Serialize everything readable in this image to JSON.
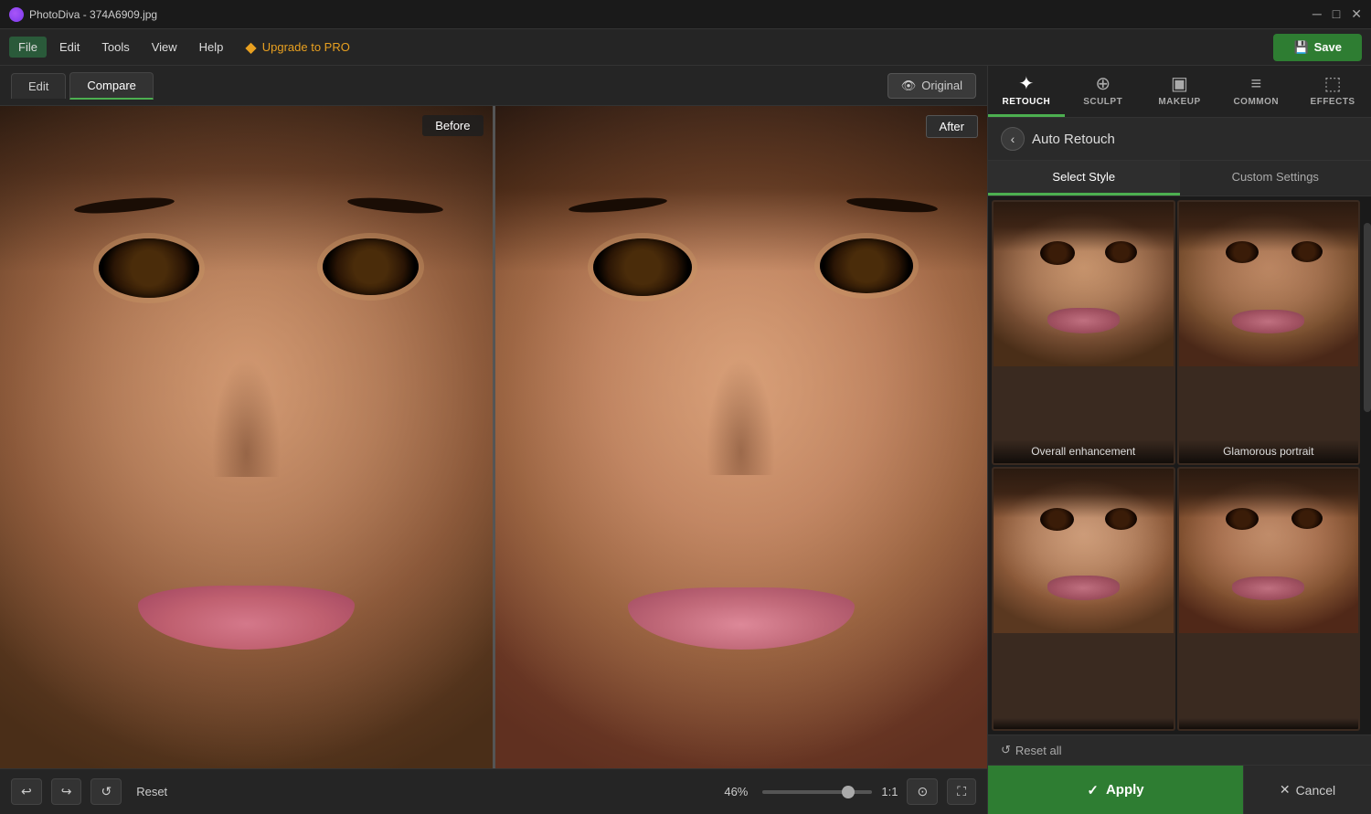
{
  "app": {
    "title": "PhotoDiva - 374A6909.jpg"
  },
  "titlebar": {
    "minimize": "─",
    "maximize": "□",
    "close": "✕"
  },
  "menubar": {
    "items": [
      "File",
      "Edit",
      "Tools",
      "View",
      "Help"
    ],
    "upgrade_label": "Upgrade to PRO",
    "save_label": "Save"
  },
  "toolbar": {
    "edit_tab": "Edit",
    "compare_tab": "Compare",
    "original_label": "Original"
  },
  "canvas": {
    "before_label": "Before",
    "after_label": "After",
    "zoom_percent": "46%",
    "zoom_ratio": "1:1",
    "reset_label": "Reset"
  },
  "panel": {
    "tabs": [
      {
        "id": "retouch",
        "label": "RETOUCH",
        "icon": "✦"
      },
      {
        "id": "sculpt",
        "label": "SCULPT",
        "icon": "⊕"
      },
      {
        "id": "makeup",
        "label": "MAKEUP",
        "icon": "⬛"
      },
      {
        "id": "common",
        "label": "COMMON",
        "icon": "≡"
      },
      {
        "id": "effects",
        "label": "EFFECTS",
        "icon": "⬚"
      }
    ],
    "active_tab": "retouch",
    "back_label": "‹",
    "title": "Auto Retouch",
    "subtabs": [
      {
        "id": "select_style",
        "label": "Select Style"
      },
      {
        "id": "custom_settings",
        "label": "Custom Settings"
      }
    ],
    "active_subtab": "select_style",
    "styles": [
      {
        "id": 1,
        "label": "Overall enhancement"
      },
      {
        "id": 2,
        "label": "Glamorous portrait"
      },
      {
        "id": 3,
        "label": ""
      },
      {
        "id": 4,
        "label": ""
      }
    ],
    "reset_label": "Reset all",
    "apply_label": "Apply",
    "cancel_label": "Cancel"
  }
}
